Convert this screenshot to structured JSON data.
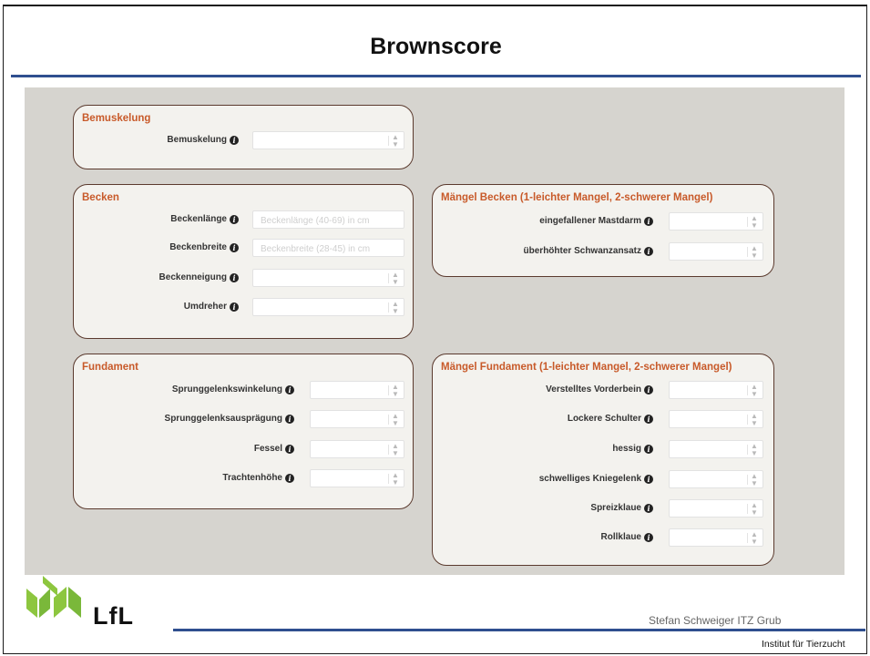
{
  "slide": {
    "title": "Brownscore"
  },
  "sections": {
    "bemuskelung": {
      "title": "Bemuskelung",
      "fields": [
        {
          "label": "Bemuskelung",
          "type": "select",
          "value": ""
        }
      ]
    },
    "becken": {
      "title": "Becken",
      "fields": [
        {
          "label": "Beckenlänge",
          "type": "text",
          "value": "",
          "placeholder": "Beckenlänge (40-69) in cm"
        },
        {
          "label": "Beckenbreite",
          "type": "text",
          "value": "",
          "placeholder": "Beckenbreite (28-45) in cm"
        },
        {
          "label": "Beckenneigung",
          "type": "select",
          "value": ""
        },
        {
          "label": "Umdreher",
          "type": "select",
          "value": ""
        }
      ]
    },
    "maengel_becken": {
      "title": "Mängel Becken (1-leichter Mangel, 2-schwerer Mangel)",
      "fields": [
        {
          "label": "eingefallener Mastdarm",
          "type": "select",
          "value": ""
        },
        {
          "label": "überhöhter Schwanzansatz",
          "type": "select",
          "value": ""
        }
      ]
    },
    "fundament": {
      "title": "Fundament",
      "fields": [
        {
          "label": "Sprunggelenkswinkelung",
          "type": "select",
          "value": ""
        },
        {
          "label": "Sprunggelenksausprägung",
          "type": "select",
          "value": ""
        },
        {
          "label": "Fessel",
          "type": "select",
          "value": ""
        },
        {
          "label": "Trachtenhöhe",
          "type": "select",
          "value": ""
        }
      ]
    },
    "maengel_fundament": {
      "title": "Mängel Fundament (1-leichter Mangel, 2-schwerer Mangel)",
      "fields": [
        {
          "label": "Verstelltes Vorderbein",
          "type": "select",
          "value": ""
        },
        {
          "label": "Lockere Schulter",
          "type": "select",
          "value": ""
        },
        {
          "label": "hessig",
          "type": "select",
          "value": ""
        },
        {
          "label": "schwelliges Kniegelenk",
          "type": "select",
          "value": ""
        },
        {
          "label": "Spreizklaue",
          "type": "select",
          "value": ""
        },
        {
          "label": "Rollklaue",
          "type": "select",
          "value": ""
        }
      ]
    }
  },
  "footer": {
    "logo_text": "LfL",
    "author": "Stefan Schweiger ITZ Grub",
    "institute": "Institut für Tierzucht"
  },
  "colors": {
    "accent_rule": "#2f4f8f",
    "section_title": "#c85a2a",
    "panel_background": "#d6d4cf",
    "logo_green": "#8dc63f"
  },
  "icons": {
    "info": "info-circle-icon",
    "select": "updown-arrows-icon"
  }
}
